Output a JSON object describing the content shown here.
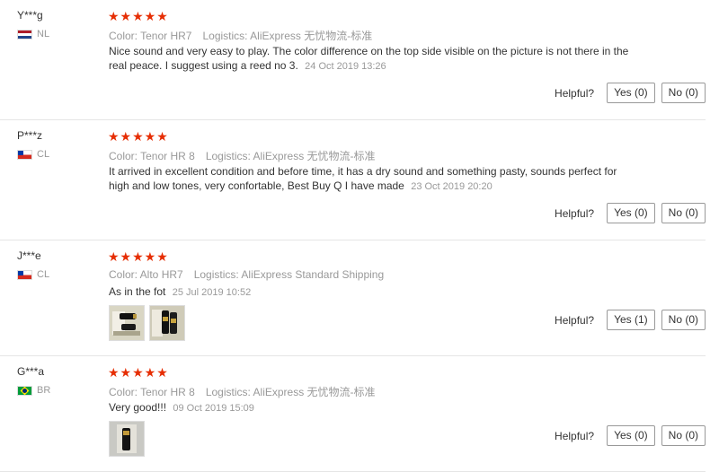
{
  "reviews": [
    {
      "user": "Y***g",
      "country": "NL",
      "stars": "★★★★★",
      "color": "Color: Tenor HR7",
      "logistics": "Logistics: AliExpress 无忧物流-标准",
      "text": "Nice sound and very easy to play. The color difference on the top side visible on the picture is not there in the real peace. I suggest using a reed no 3.",
      "date": "24 Oct 2019 13:26",
      "helpful": "Helpful?",
      "yes": "Yes (0)",
      "no": "No (0)"
    },
    {
      "user": "P***z",
      "country": "CL",
      "stars": "★★★★★",
      "color": "Color: Tenor HR 8",
      "logistics": "Logistics: AliExpress 无忧物流-标准",
      "text": "It arrived in excellent condition and before time, it has a dry sound and something pasty, sounds perfect for high and low tones, very confortable, Best Buy Q I have made",
      "date": "23 Oct 2019 20:20",
      "helpful": "Helpful?",
      "yes": "Yes (0)",
      "no": "No (0)"
    },
    {
      "user": "J***e",
      "country": "CL",
      "stars": "★★★★★",
      "color": "Color: Alto HR7",
      "logistics": "Logistics: AliExpress Standard Shipping",
      "text": "As in the fot",
      "date": "25 Jul 2019 10:52",
      "helpful": "Helpful?",
      "yes": "Yes (1)",
      "no": "No (0)"
    },
    {
      "user": "G***a",
      "country": "BR",
      "stars": "★★★★★",
      "color": "Color: Tenor HR 8",
      "logistics": "Logistics: AliExpress 无忧物流-标准",
      "text": "Very good!!!",
      "date": "09 Oct 2019 15:09",
      "helpful": "Helpful?",
      "yes": "Yes (0)",
      "no": "No (0)"
    }
  ],
  "colors": {
    "star": "#e62e04",
    "muted": "#999999",
    "border": "#e5e5e5"
  }
}
